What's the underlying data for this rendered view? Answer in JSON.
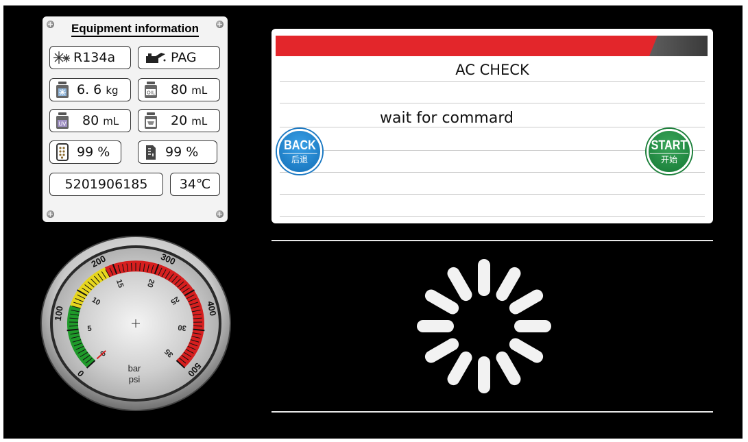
{
  "equipment": {
    "title": "Equipment information",
    "refrigerant": "R134a",
    "oil_type": "PAG",
    "refrigerant_amount": {
      "value": "6. 6",
      "unit": "kg"
    },
    "oil_amount": {
      "value": "80",
      "unit": "mL"
    },
    "uv_dye": {
      "value": "80",
      "unit": "mL"
    },
    "waste_oil": {
      "value": "20",
      "unit": "mL"
    },
    "filter_level": "99 %",
    "tank_level": "99 %",
    "serial_number": "5201906185",
    "temperature": "34℃",
    "icons": [
      "snowflake-icon",
      "oil-can-icon",
      "refrigerant-bottle-icon",
      "oil-bottle-icon",
      "uv-bottle-icon",
      "waste-oil-bottle-icon",
      "filter-icon",
      "tank-icon"
    ]
  },
  "panel": {
    "title": "AC CHECK",
    "message": "wait for commard",
    "accent_color": "#e3262b"
  },
  "buttons": {
    "back": {
      "label": "BACK",
      "sub": "后退",
      "color": "#1a78c2"
    },
    "start": {
      "label": "START",
      "sub": "开始",
      "color": "#1b7f3a"
    }
  },
  "gauge": {
    "units": [
      "bar",
      "psi"
    ],
    "bar_labels": [
      "0",
      "5",
      "10",
      "15",
      "20",
      "25",
      "30",
      "35"
    ],
    "psi_labels": [
      "0",
      "100",
      "200",
      "300",
      "400",
      "500"
    ]
  },
  "status": {
    "loading": true,
    "icon": "loading-spinner-icon"
  }
}
